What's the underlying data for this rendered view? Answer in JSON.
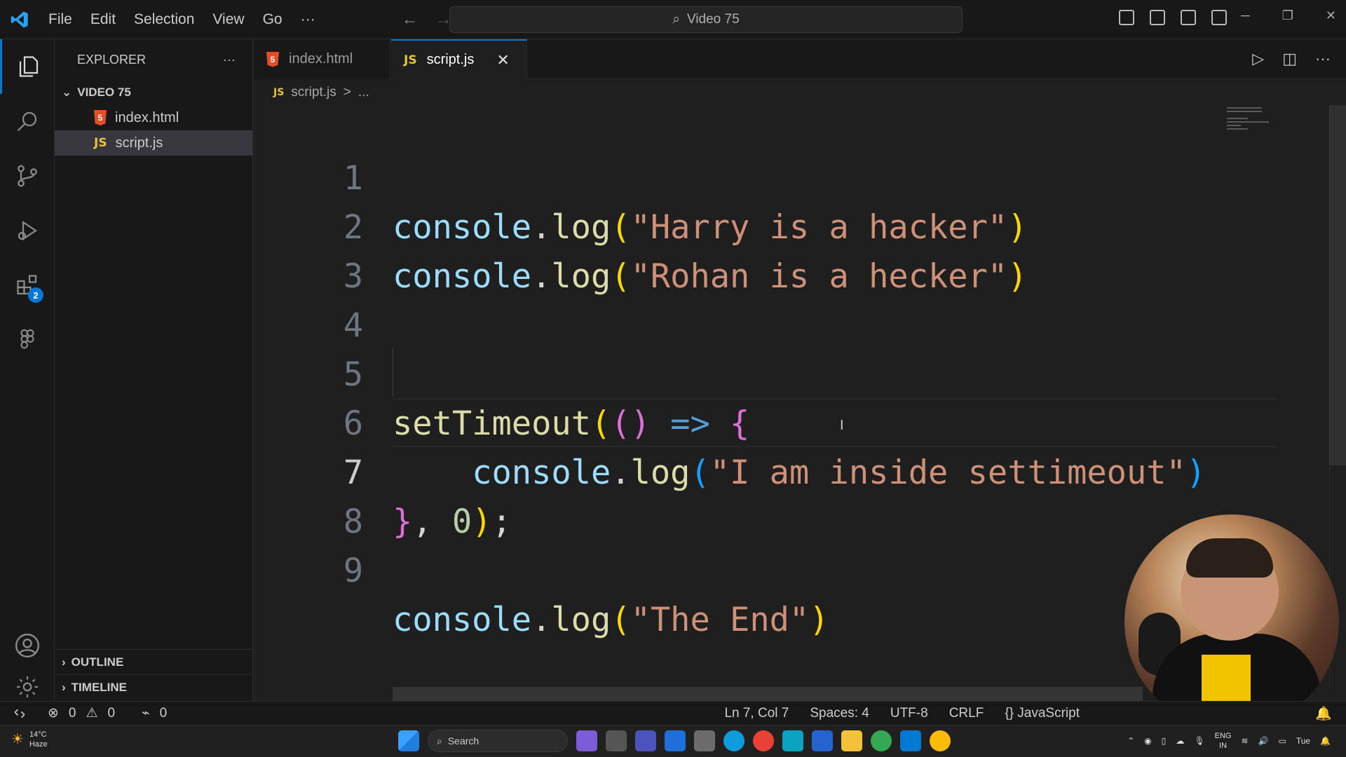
{
  "window": {
    "search_text": "Video 75"
  },
  "menu": [
    "File",
    "Edit",
    "Selection",
    "View",
    "Go",
    "···"
  ],
  "activity": {
    "extensions_badge": "2"
  },
  "sidebar": {
    "title": "EXPLORER",
    "more": "···",
    "folder": "VIDEO 75",
    "files": [
      {
        "name": "index.html",
        "icon": "html5-icon"
      },
      {
        "name": "script.js",
        "icon": "js-icon"
      }
    ],
    "outline": "OUTLINE",
    "timeline": "TIMELINE"
  },
  "tabs": [
    {
      "label": "index.html",
      "icon": "html5-icon",
      "active": false
    },
    {
      "label": "script.js",
      "icon": "js-icon",
      "active": true,
      "close": "✕"
    }
  ],
  "breadcrumb": {
    "file": "script.js",
    "sep": ">",
    "more": "..."
  },
  "editor": {
    "line_numbers": [
      "1",
      "2",
      "3",
      "4",
      "5",
      "6",
      "7",
      "8",
      "9"
    ],
    "current_line": "7",
    "lines": [
      "console.log(\"Harry is a hacker\")",
      "console.log(\"Rohan is a hecker\")",
      "",
      "",
      "setTimeout(() => {",
      "    console.log(\"I am inside settimeout\")",
      "}, 0);",
      "",
      "console.log(\"The End\")"
    ]
  },
  "statusbar": {
    "errors": "0",
    "warnings": "0",
    "ports": "0",
    "position": "Ln 7, Col 7",
    "spaces": "Spaces: 4",
    "encoding": "UTF-8",
    "eol": "CRLF",
    "language": "JavaScript"
  },
  "taskbar": {
    "temperature": "14°C",
    "weather": "Haze",
    "search": "Search",
    "lang": "ENG",
    "region": "IN",
    "day": "Tue"
  },
  "colors": {
    "accent": "#0078d4",
    "editor_bg": "#1f1f1f",
    "chrome_bg": "#181818",
    "html_icon": "#e44d26",
    "js_icon": "#e8c53a"
  }
}
